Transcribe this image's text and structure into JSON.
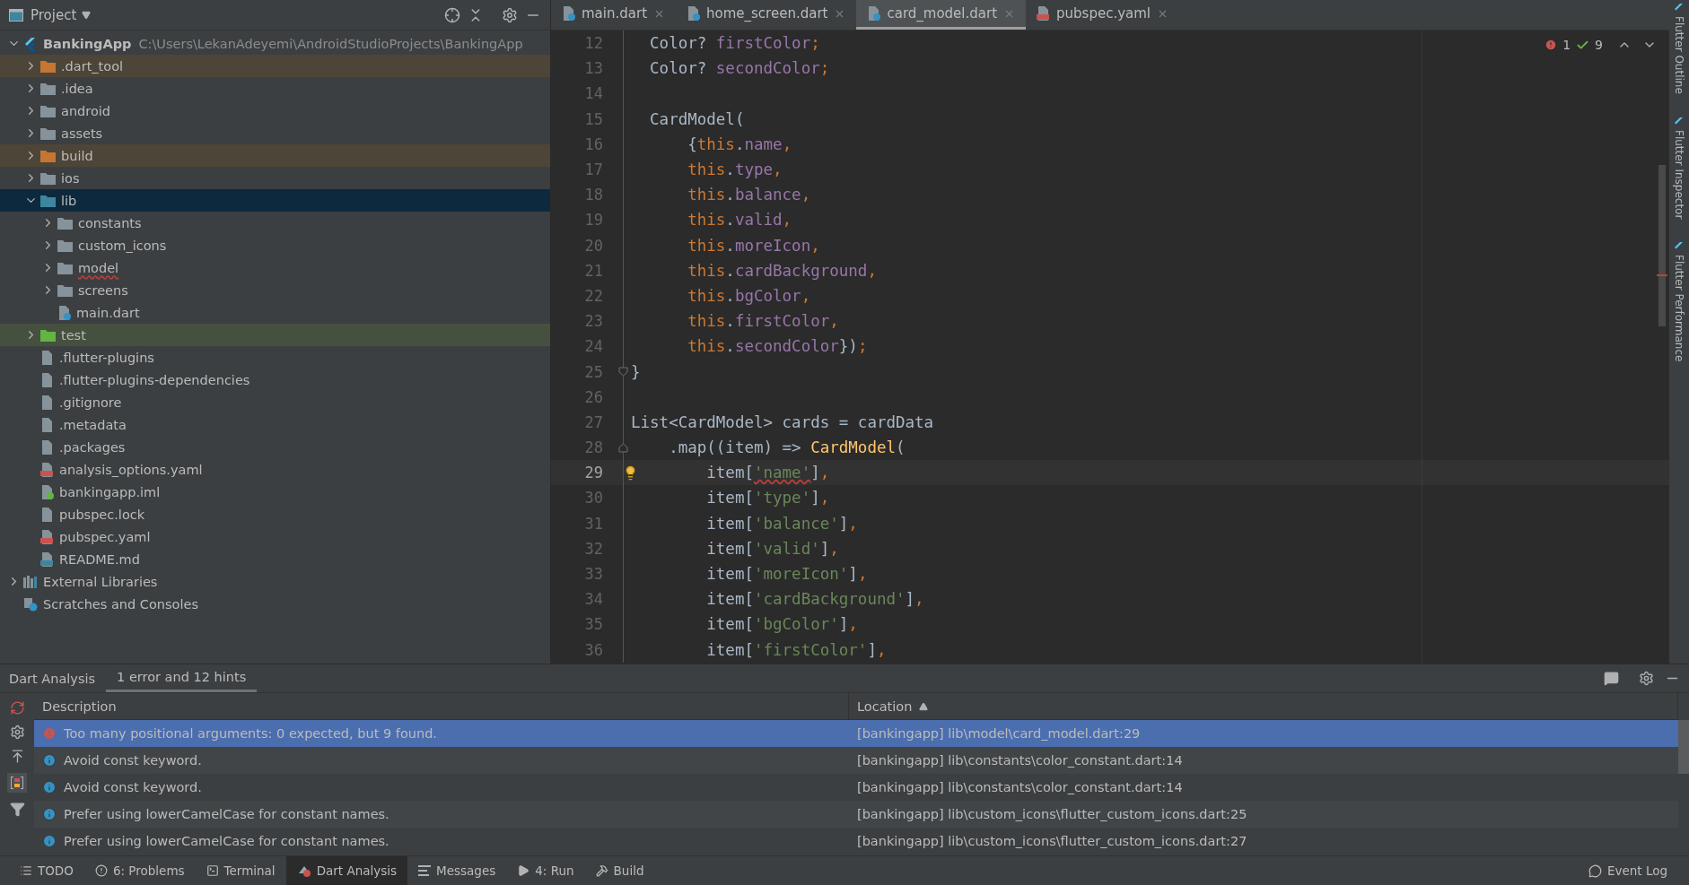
{
  "project_panel": {
    "title": "Project",
    "tree": [
      {
        "name": "BankingApp",
        "kind": "project",
        "path": "C:\\Users\\LekanAdeyemi\\AndroidStudioProjects\\BankingApp",
        "expanded": true,
        "selected": false,
        "children": [
          {
            "name": ".dart_tool",
            "kind": "folder-excluded",
            "expanded": false,
            "selected": false
          },
          {
            "name": ".idea",
            "kind": "folder",
            "expanded": false,
            "selected": false
          },
          {
            "name": "android",
            "kind": "folder",
            "expanded": false,
            "selected": false
          },
          {
            "name": "assets",
            "kind": "folder",
            "expanded": false,
            "selected": false
          },
          {
            "name": "build",
            "kind": "folder-excluded",
            "expanded": false,
            "selected": false
          },
          {
            "name": "ios",
            "kind": "folder",
            "expanded": false,
            "selected": false
          },
          {
            "name": "lib",
            "kind": "folder-source",
            "expanded": true,
            "selected": true,
            "children": [
              {
                "name": "constants",
                "kind": "folder",
                "expanded": false,
                "selected": false
              },
              {
                "name": "custom_icons",
                "kind": "folder",
                "expanded": false,
                "selected": false
              },
              {
                "name": "model",
                "kind": "folder-error",
                "expanded": false,
                "selected": false
              },
              {
                "name": "screens",
                "kind": "folder",
                "expanded": false,
                "selected": false
              },
              {
                "name": "main.dart",
                "kind": "dart",
                "selected": false
              }
            ]
          },
          {
            "name": "test",
            "kind": "folder-test",
            "expanded": false,
            "selected": false
          },
          {
            "name": ".flutter-plugins",
            "kind": "file",
            "selected": false
          },
          {
            "name": ".flutter-plugins-dependencies",
            "kind": "file",
            "selected": false
          },
          {
            "name": ".gitignore",
            "kind": "file",
            "selected": false
          },
          {
            "name": ".metadata",
            "kind": "file",
            "selected": false
          },
          {
            "name": ".packages",
            "kind": "file",
            "selected": false
          },
          {
            "name": "analysis_options.yaml",
            "kind": "yaml",
            "selected": false
          },
          {
            "name": "bankingapp.iml",
            "kind": "iml",
            "selected": false
          },
          {
            "name": "pubspec.lock",
            "kind": "file",
            "selected": false
          },
          {
            "name": "pubspec.yaml",
            "kind": "yaml",
            "selected": false
          },
          {
            "name": "README.md",
            "kind": "md",
            "selected": false
          }
        ]
      },
      {
        "name": "External Libraries",
        "kind": "libraries",
        "expanded": false,
        "selected": false
      },
      {
        "name": "Scratches and Consoles",
        "kind": "scratches",
        "selected": false
      }
    ]
  },
  "editor": {
    "tabs": [
      {
        "label": "main.dart",
        "kind": "dart",
        "selected": false
      },
      {
        "label": "home_screen.dart",
        "kind": "dart",
        "selected": false
      },
      {
        "label": "card_model.dart",
        "kind": "dart",
        "selected": true
      },
      {
        "label": "pubspec.yaml",
        "kind": "yaml",
        "selected": false
      }
    ],
    "errors": "1",
    "warnings": "9",
    "lines": [
      {
        "number": "12",
        "current": false,
        "tokens": [
          {
            "text": "  Color? ",
            "kind": "plain"
          },
          {
            "text": "firstColor",
            "kind": "field"
          },
          {
            "text": ";",
            "kind": "keyword"
          }
        ]
      },
      {
        "number": "13",
        "current": false,
        "tokens": [
          {
            "text": "  Color? ",
            "kind": "plain"
          },
          {
            "text": "secondColor",
            "kind": "field"
          },
          {
            "text": ";",
            "kind": "keyword"
          }
        ]
      },
      {
        "number": "14",
        "current": false
      },
      {
        "number": "15",
        "current": false,
        "tokens": [
          {
            "text": "  CardModel(",
            "kind": "plain"
          }
        ]
      },
      {
        "number": "16",
        "current": false,
        "tokens": [
          {
            "text": "      {",
            "kind": "plain"
          },
          {
            "text": "this",
            "kind": "keyword"
          },
          {
            "text": ".",
            "kind": "plain"
          },
          {
            "text": "name",
            "kind": "field"
          },
          {
            "text": ",",
            "kind": "keyword"
          }
        ]
      },
      {
        "number": "17",
        "current": false,
        "tokens": [
          {
            "text": "      this",
            "kind": "keyword"
          },
          {
            "text": ".",
            "kind": "plain"
          },
          {
            "text": "type",
            "kind": "field"
          },
          {
            "text": ",",
            "kind": "keyword"
          }
        ]
      },
      {
        "number": "18",
        "current": false,
        "tokens": [
          {
            "text": "      this",
            "kind": "keyword"
          },
          {
            "text": ".",
            "kind": "plain"
          },
          {
            "text": "balance",
            "kind": "field"
          },
          {
            "text": ",",
            "kind": "keyword"
          }
        ]
      },
      {
        "number": "19",
        "current": false,
        "tokens": [
          {
            "text": "      this",
            "kind": "keyword"
          },
          {
            "text": ".",
            "kind": "plain"
          },
          {
            "text": "valid",
            "kind": "field"
          },
          {
            "text": ",",
            "kind": "keyword"
          }
        ]
      },
      {
        "number": "20",
        "current": false,
        "tokens": [
          {
            "text": "      this",
            "kind": "keyword"
          },
          {
            "text": ".",
            "kind": "plain"
          },
          {
            "text": "moreIcon",
            "kind": "field"
          },
          {
            "text": ",",
            "kind": "keyword"
          }
        ]
      },
      {
        "number": "21",
        "current": false,
        "tokens": [
          {
            "text": "      this",
            "kind": "keyword"
          },
          {
            "text": ".",
            "kind": "plain"
          },
          {
            "text": "cardBackground",
            "kind": "field"
          },
          {
            "text": ",",
            "kind": "keyword"
          }
        ]
      },
      {
        "number": "22",
        "current": false,
        "tokens": [
          {
            "text": "      this",
            "kind": "keyword"
          },
          {
            "text": ".",
            "kind": "plain"
          },
          {
            "text": "bgColor",
            "kind": "field"
          },
          {
            "text": ",",
            "kind": "keyword"
          }
        ]
      },
      {
        "number": "23",
        "current": false,
        "tokens": [
          {
            "text": "      this",
            "kind": "keyword"
          },
          {
            "text": ".",
            "kind": "plain"
          },
          {
            "text": "firstColor",
            "kind": "field"
          },
          {
            "text": ",",
            "kind": "keyword"
          }
        ]
      },
      {
        "number": "24",
        "current": false,
        "tokens": [
          {
            "text": "      this",
            "kind": "keyword"
          },
          {
            "text": ".",
            "kind": "plain"
          },
          {
            "text": "secondColor",
            "kind": "field"
          },
          {
            "text": "})",
            "kind": "plain"
          },
          {
            "text": ";",
            "kind": "keyword"
          }
        ]
      },
      {
        "number": "25",
        "current": false,
        "kind": "fold-end",
        "tokens": [
          {
            "text": "}",
            "kind": "plain"
          }
        ]
      },
      {
        "number": "26",
        "current": false
      },
      {
        "number": "27",
        "current": false,
        "tokens": [
          {
            "text": "List<CardModel> cards = cardData",
            "kind": "plain"
          }
        ]
      },
      {
        "number": "28",
        "current": false,
        "kind": "fold-start",
        "tokens": [
          {
            "text": "    .map((item) => ",
            "kind": "plain"
          },
          {
            "text": "CardModel",
            "kind": "class"
          },
          {
            "text": "(",
            "kind": "plain"
          }
        ]
      },
      {
        "number": "29",
        "current": true,
        "tokens": [
          {
            "text": "        item[",
            "kind": "plain"
          },
          {
            "text": "'name'",
            "kind": "string-error"
          },
          {
            "text": "]",
            "kind": "plain"
          },
          {
            "text": ",",
            "kind": "keyword"
          }
        ]
      },
      {
        "number": "30",
        "current": false,
        "tokens": [
          {
            "text": "        item[",
            "kind": "plain"
          },
          {
            "text": "'type'",
            "kind": "string"
          },
          {
            "text": "]",
            "kind": "plain"
          },
          {
            "text": ",",
            "kind": "keyword"
          }
        ]
      },
      {
        "number": "31",
        "current": false,
        "tokens": [
          {
            "text": "        item[",
            "kind": "plain"
          },
          {
            "text": "'balance'",
            "kind": "string"
          },
          {
            "text": "]",
            "kind": "plain"
          },
          {
            "text": ",",
            "kind": "keyword"
          }
        ]
      },
      {
        "number": "32",
        "current": false,
        "tokens": [
          {
            "text": "        item[",
            "kind": "plain"
          },
          {
            "text": "'valid'",
            "kind": "string"
          },
          {
            "text": "]",
            "kind": "plain"
          },
          {
            "text": ",",
            "kind": "keyword"
          }
        ]
      },
      {
        "number": "33",
        "current": false,
        "tokens": [
          {
            "text": "        item[",
            "kind": "plain"
          },
          {
            "text": "'moreIcon'",
            "kind": "string"
          },
          {
            "text": "]",
            "kind": "plain"
          },
          {
            "text": ",",
            "kind": "keyword"
          }
        ]
      },
      {
        "number": "34",
        "current": false,
        "tokens": [
          {
            "text": "        item[",
            "kind": "plain"
          },
          {
            "text": "'cardBackground'",
            "kind": "string"
          },
          {
            "text": "]",
            "kind": "plain"
          },
          {
            "text": ",",
            "kind": "keyword"
          }
        ]
      },
      {
        "number": "35",
        "current": false,
        "tokens": [
          {
            "text": "        item[",
            "kind": "plain"
          },
          {
            "text": "'bgColor'",
            "kind": "string"
          },
          {
            "text": "]",
            "kind": "plain"
          },
          {
            "text": ",",
            "kind": "keyword"
          }
        ]
      },
      {
        "number": "36",
        "current": false,
        "tokens": [
          {
            "text": "        item[",
            "kind": "plain"
          },
          {
            "text": "'firstColor'",
            "kind": "string"
          },
          {
            "text": "]",
            "kind": "plain"
          },
          {
            "text": ",",
            "kind": "keyword"
          }
        ]
      }
    ]
  },
  "side_tools": [
    "Flutter Outline",
    "Flutter Inspector",
    "Flutter Performance"
  ],
  "analysis": {
    "title": "Dart Analysis",
    "tabs": [
      {
        "label": "1 error and 12 hints",
        "selected": true
      }
    ],
    "columns": [
      "Description",
      "Location"
    ],
    "rows": [
      {
        "kind": "error",
        "description": "Too many positional arguments: 0 expected, but 9 found.",
        "location": "[bankingapp] lib\\model\\card_model.dart:29",
        "selected": true
      },
      {
        "kind": "info",
        "description": "Avoid const keyword.",
        "location": "[bankingapp] lib\\constants\\color_constant.dart:14",
        "selected": false
      },
      {
        "kind": "info",
        "description": "Avoid const keyword.",
        "location": "[bankingapp] lib\\constants\\color_constant.dart:14",
        "selected": false
      },
      {
        "kind": "info",
        "description": "Prefer using lowerCamelCase for constant names.",
        "location": "[bankingapp] lib\\custom_icons\\flutter_custom_icons.dart:25",
        "selected": false
      },
      {
        "kind": "info",
        "description": "Prefer using lowerCamelCase for constant names.",
        "location": "[bankingapp] lib\\custom_icons\\flutter_custom_icons.dart:27",
        "selected": false
      }
    ]
  },
  "status_bar": {
    "tools": [
      {
        "label": "TODO",
        "kind": "todo",
        "selected": false
      },
      {
        "label": "6: Problems",
        "kind": "problems",
        "selected": false
      },
      {
        "label": "Terminal",
        "kind": "terminal",
        "selected": false
      },
      {
        "label": "Dart Analysis",
        "kind": "analysis",
        "selected": true
      },
      {
        "label": "Messages",
        "kind": "messages",
        "selected": false
      },
      {
        "label": "4: Run",
        "kind": "run",
        "selected": false
      },
      {
        "label": "Build",
        "kind": "build",
        "selected": false
      }
    ],
    "event_log": "Event Log"
  }
}
